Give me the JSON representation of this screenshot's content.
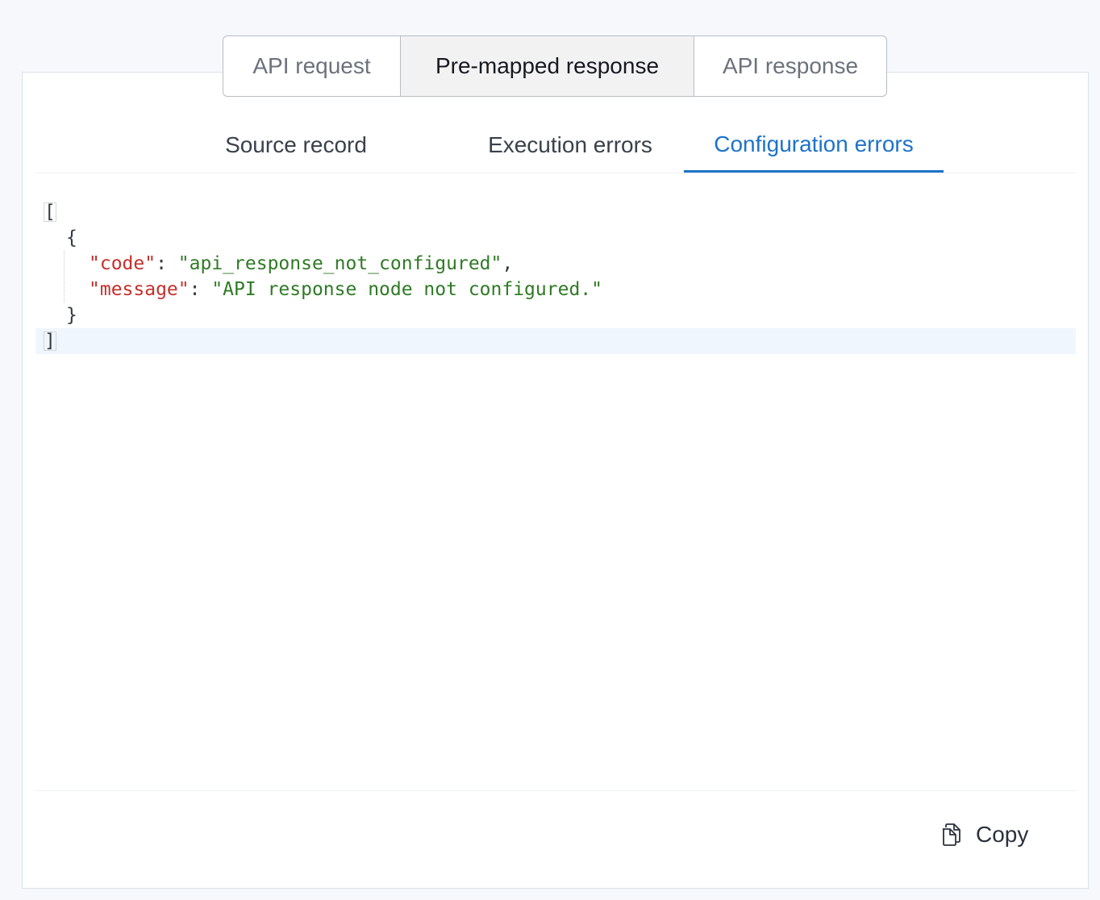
{
  "segmented": {
    "items": [
      "API request",
      "Pre-mapped response",
      "API response"
    ],
    "selected": "Pre-mapped response"
  },
  "subtabs": {
    "items": [
      "Source record",
      "Execution errors",
      "Configuration errors"
    ],
    "active": "Configuration errors"
  },
  "json_view": {
    "open_bracket": "[",
    "open_brace": "{",
    "entries": [
      {
        "key": "\"code\"",
        "sep": ": ",
        "value": "\"api_response_not_configured\"",
        "trail": ","
      },
      {
        "key": "\"message\"",
        "sep": ": ",
        "value": "\"API response node not configured.\"",
        "trail": ""
      }
    ],
    "close_brace": "}",
    "close_bracket": "]"
  },
  "footer": {
    "copy_label": "Copy",
    "copy_icon": "copy-icon"
  },
  "colors": {
    "accent": "#1e73c8",
    "json_key": "#c4302b",
    "json_string": "#2f7a25",
    "highlight_line": "#eff6fd"
  }
}
